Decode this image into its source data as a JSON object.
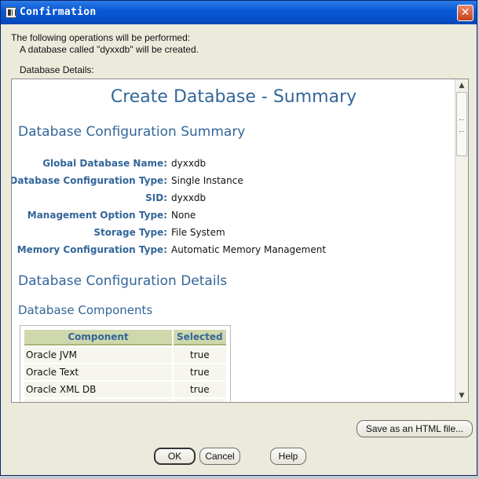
{
  "window": {
    "title": "Confirmation",
    "close_label": "✕"
  },
  "intro": {
    "line1": "The following operations will be performed:",
    "line2": "A database called \"dyxxdb\" will be created.",
    "details_label": "Database Details:"
  },
  "summary": {
    "title": "Create Database - Summary",
    "config_summary_heading": "Database Configuration Summary",
    "config_rows": [
      {
        "key": "Global Database Name:",
        "value": "dyxxdb"
      },
      {
        "key": "Database Configuration Type:",
        "value": "Single Instance"
      },
      {
        "key": "SID:",
        "value": "dyxxdb"
      },
      {
        "key": "Management Option Type:",
        "value": "None"
      },
      {
        "key": "Storage Type:",
        "value": "File System"
      },
      {
        "key": "Memory Configuration Type:",
        "value": "Automatic Memory Management"
      }
    ],
    "config_details_heading": "Database Configuration Details",
    "components_heading": "Database Components",
    "components_table": {
      "headers": [
        "Component",
        "Selected"
      ],
      "rows": [
        [
          "Oracle JVM",
          "true"
        ],
        [
          "Oracle Text",
          "true"
        ],
        [
          "Oracle XML DB",
          "true"
        ]
      ]
    }
  },
  "buttons": {
    "save_html": "Save as an HTML file...",
    "ok": "OK",
    "cancel": "Cancel",
    "help": "Help"
  },
  "colors": {
    "heading": "#336699",
    "titlebar": "#0a5bd6",
    "table_header": "#cfd8ac"
  }
}
